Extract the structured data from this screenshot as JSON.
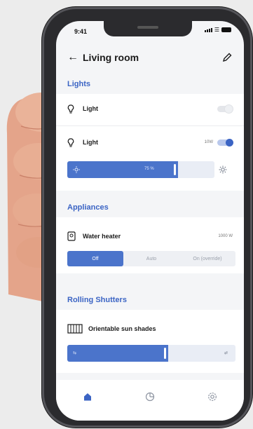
{
  "status": {
    "time": "9:41"
  },
  "header": {
    "title": "Living room"
  },
  "lights": {
    "section_title": "Lights",
    "items": [
      {
        "label": "Light",
        "on": false
      },
      {
        "label": "Light",
        "wattage": "10W",
        "on": true
      }
    ],
    "brightness": {
      "value_label": "75 %",
      "level": 0.75
    }
  },
  "appliances": {
    "section_title": "Appliances",
    "item": {
      "label": "Water heater",
      "wattage": "1000 W"
    },
    "modes": [
      "Off",
      "Auto",
      "On (override)"
    ],
    "selected_mode": "Off"
  },
  "shutters": {
    "section_title": "Rolling Shutters",
    "item": {
      "label": "Orientable sun shades"
    },
    "position": {
      "level": 0.6
    }
  },
  "tabbar": {
    "items": [
      "home-icon",
      "history-icon",
      "settings-icon"
    ]
  },
  "colors": {
    "accent": "#3b64c4",
    "slider": "#4b74cb",
    "background": "#f4f5f7"
  }
}
